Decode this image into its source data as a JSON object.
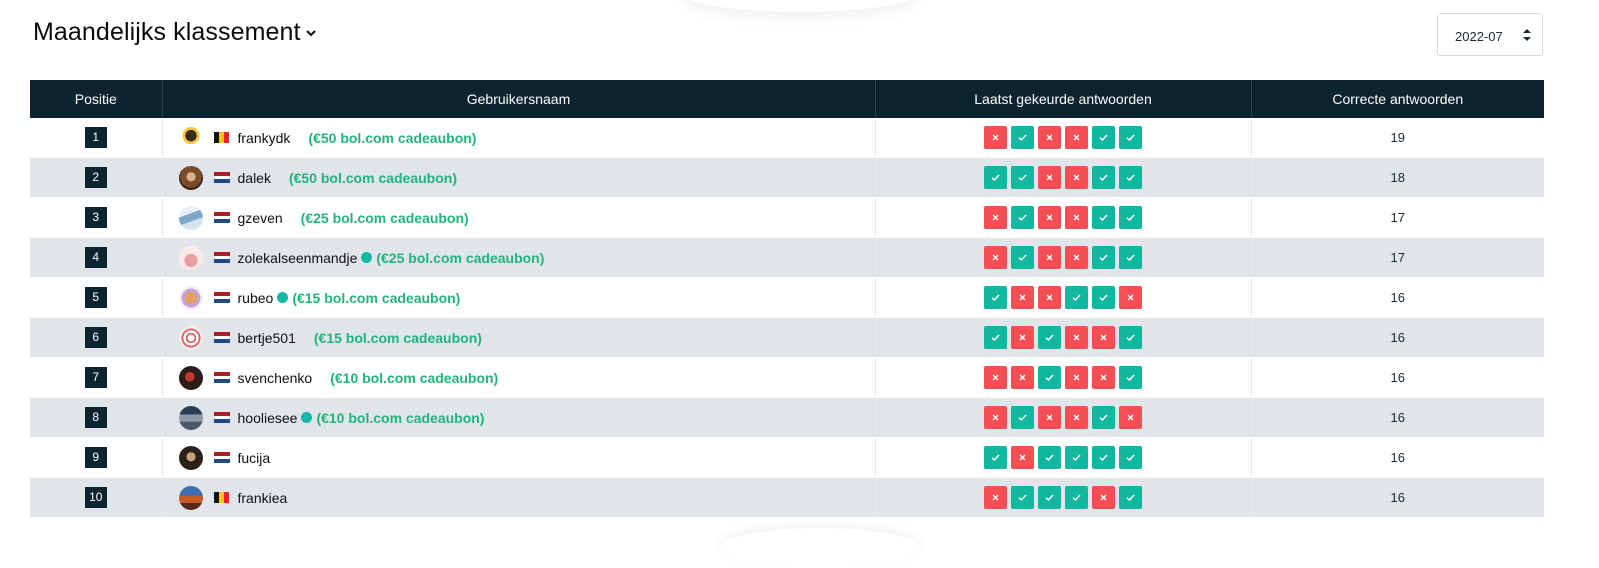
{
  "header": {
    "title": "Maandelijks klassement",
    "chevron_icon": "chevron-down-icon"
  },
  "month_select": {
    "value": "2022-07",
    "icon": "sort-arrows-icon"
  },
  "colors": {
    "header_bg": "#0c2330",
    "correct": "#12b7a0",
    "wrong": "#f44f55",
    "prize": "#21b57a",
    "online": "#14b8a6"
  },
  "table": {
    "columns": [
      "Positie",
      "Gebruikersnaam",
      "Laatst gekeurde antwoorden",
      "Correcte antwoorden"
    ],
    "rows": [
      {
        "position": "1",
        "flag": "be",
        "username": "frankydk",
        "online": false,
        "prize": "(€50 bol.com cadeaubon)",
        "answers": [
          "wrong",
          "correct",
          "wrong",
          "wrong",
          "correct",
          "correct"
        ],
        "correct": "19"
      },
      {
        "position": "2",
        "flag": "nl",
        "username": "dalek",
        "online": false,
        "prize": "(€50 bol.com cadeaubon)",
        "answers": [
          "correct",
          "correct",
          "wrong",
          "wrong",
          "correct",
          "correct"
        ],
        "correct": "18"
      },
      {
        "position": "3",
        "flag": "nl",
        "username": "gzeven",
        "online": false,
        "prize": "(€25 bol.com cadeaubon)",
        "answers": [
          "wrong",
          "correct",
          "wrong",
          "wrong",
          "correct",
          "correct"
        ],
        "correct": "17"
      },
      {
        "position": "4",
        "flag": "nl",
        "username": "zolekalseenmandje",
        "online": true,
        "prize": "(€25 bol.com cadeaubon)",
        "answers": [
          "wrong",
          "correct",
          "wrong",
          "wrong",
          "correct",
          "correct"
        ],
        "correct": "17"
      },
      {
        "position": "5",
        "flag": "nl",
        "username": "rubeo",
        "online": true,
        "prize": "(€15 bol.com cadeaubon)",
        "answers": [
          "correct",
          "wrong",
          "wrong",
          "correct",
          "correct",
          "wrong"
        ],
        "correct": "16"
      },
      {
        "position": "6",
        "flag": "nl",
        "username": "bertje501",
        "online": false,
        "prize": "(€15 bol.com cadeaubon)",
        "answers": [
          "correct",
          "wrong",
          "correct",
          "wrong",
          "wrong",
          "correct"
        ],
        "correct": "16"
      },
      {
        "position": "7",
        "flag": "nl",
        "username": "svenchenko",
        "online": false,
        "prize": "(€10 bol.com cadeaubon)",
        "answers": [
          "wrong",
          "wrong",
          "correct",
          "wrong",
          "wrong",
          "correct"
        ],
        "correct": "16"
      },
      {
        "position": "8",
        "flag": "nl",
        "username": "hooliesee",
        "online": true,
        "prize": "(€10 bol.com cadeaubon)",
        "answers": [
          "wrong",
          "correct",
          "wrong",
          "wrong",
          "correct",
          "wrong"
        ],
        "correct": "16"
      },
      {
        "position": "9",
        "flag": "nl",
        "username": "fucija",
        "online": false,
        "prize": "",
        "answers": [
          "correct",
          "wrong",
          "correct",
          "correct",
          "correct",
          "correct"
        ],
        "correct": "16"
      },
      {
        "position": "10",
        "flag": "be",
        "username": "frankiea",
        "online": false,
        "prize": "",
        "answers": [
          "wrong",
          "correct",
          "correct",
          "correct",
          "wrong",
          "correct"
        ],
        "correct": "16"
      }
    ]
  }
}
